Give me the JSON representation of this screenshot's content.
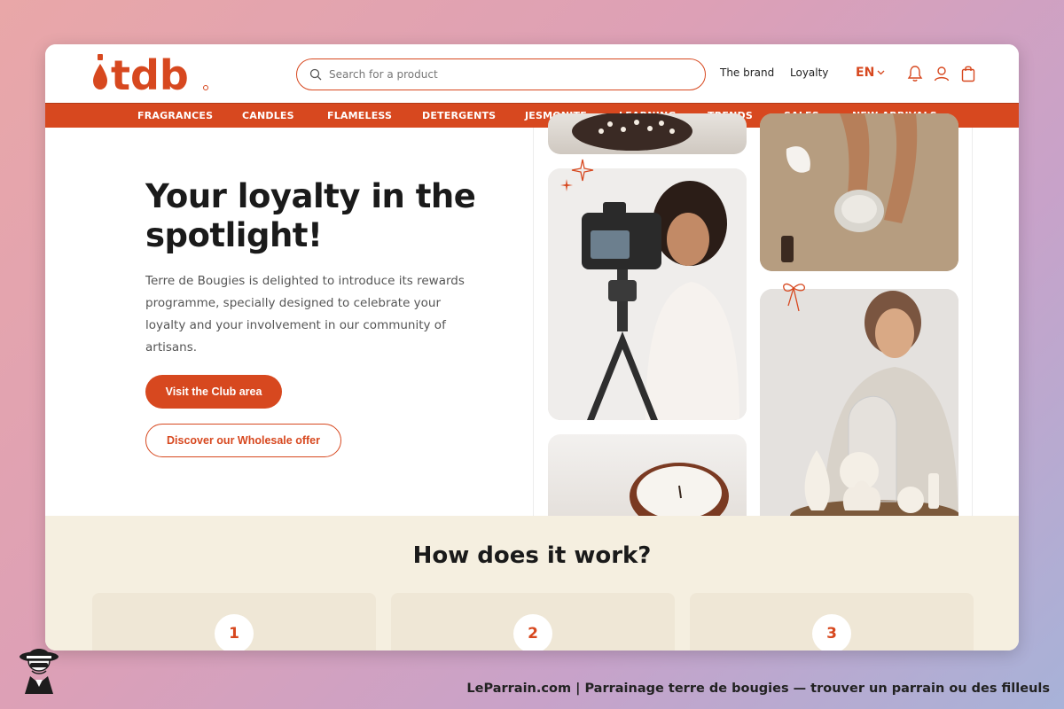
{
  "header": {
    "logo_text": "tdb",
    "search_placeholder": "Search for a product",
    "links": [
      "The brand",
      "Loyalty"
    ],
    "language": "EN",
    "icons": [
      "bell-icon",
      "user-icon",
      "cart-icon"
    ]
  },
  "nav": {
    "items": [
      "FRAGRANCES",
      "CANDLES",
      "FLAMELESS",
      "DETERGENTS",
      "JESMONITE",
      "LEARNING",
      "TRENDS",
      "SALES",
      "NEW ARRIVALS"
    ]
  },
  "hero": {
    "title": "Your loyalty in the spotlight!",
    "text": "Terre de Bougies is delighted to introduce its rewards programme, specially designed to celebrate your loyalty and your involvement in our community of artisans.",
    "primary_button": "Visit the Club area",
    "secondary_button": "Discover our Wholesale offer"
  },
  "how": {
    "title": "How does it work?",
    "steps": [
      "1",
      "2",
      "3"
    ]
  },
  "footer": {
    "caption": "LeParrain.com | Parrainage terre de bougies — trouver un parrain ou des filleuls"
  },
  "colors": {
    "accent": "#d7481f",
    "section_bg": "#f5efe0"
  }
}
